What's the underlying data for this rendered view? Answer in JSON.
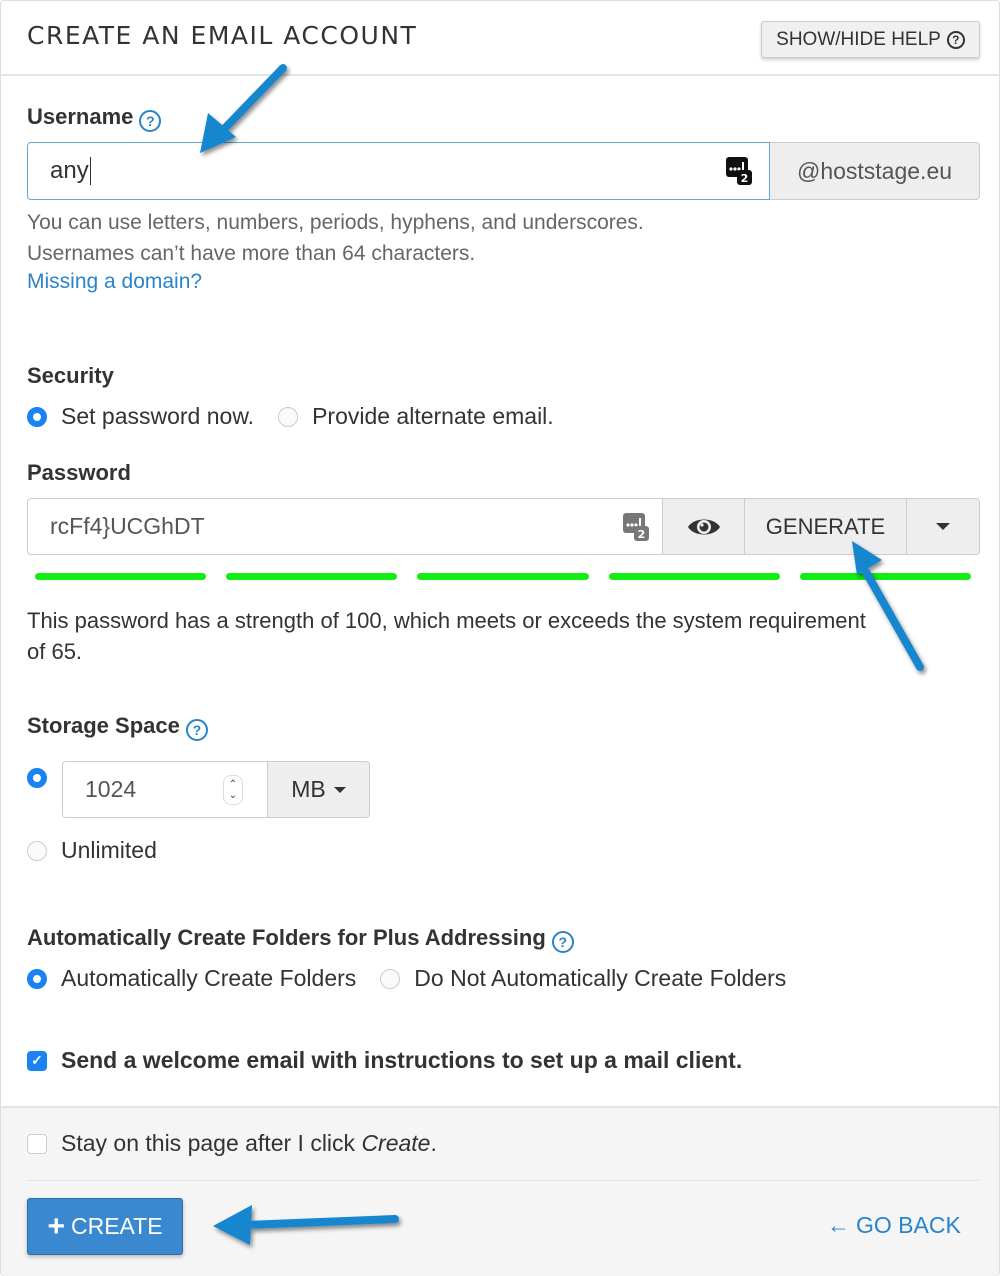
{
  "header": {
    "title": "CREATE AN EMAIL ACCOUNT",
    "help_toggle_label": "SHOW/HIDE HELP",
    "help_icon": "question-circle-icon"
  },
  "username": {
    "label": "Username",
    "value": "any",
    "domain": "@hoststage.eu",
    "help_text": "You can use letters, numbers, periods, hyphens, and underscores. Usernames can’t have more than 64 characters.",
    "missing_domain_link": "Missing a domain?"
  },
  "security": {
    "label": "Security",
    "options": [
      {
        "label": "Set password now.",
        "selected": true
      },
      {
        "label": "Provide alternate email.",
        "selected": false
      }
    ]
  },
  "password": {
    "label": "Password",
    "value": "rcFf4}UCGhDT",
    "generate_label": "GENERATE",
    "strength_segments_filled": 5,
    "strength_segments_total": 5,
    "strength_color": "#11ee11",
    "strength_text": "This password has a strength of 100, which meets or exceeds the system requirement of 65."
  },
  "storage": {
    "label": "Storage Space",
    "quota_value": "1024",
    "unit": "MB",
    "options": [
      {
        "label": "",
        "selected": true
      },
      {
        "label": "Unlimited",
        "selected": false
      }
    ]
  },
  "plus_addressing": {
    "label": "Automatically Create Folders for Plus Addressing",
    "options": [
      {
        "label": "Automatically Create Folders",
        "selected": true
      },
      {
        "label": "Do Not Automatically Create Folders",
        "selected": false
      }
    ]
  },
  "welcome_email": {
    "label": "Send a welcome email with instructions to set up a mail client.",
    "checked": true
  },
  "footer": {
    "stay_prefix": "Stay on this page after I click ",
    "stay_emph": "Create",
    "stay_suffix": ".",
    "stay_checked": false,
    "create_label": "CREATE",
    "go_back_label": "GO BACK"
  },
  "colors": {
    "accent": "#2a84c9",
    "radio_checked": "#1a82f3",
    "primary_button": "#3a88d0",
    "annotation_arrow": "#1786cf"
  }
}
